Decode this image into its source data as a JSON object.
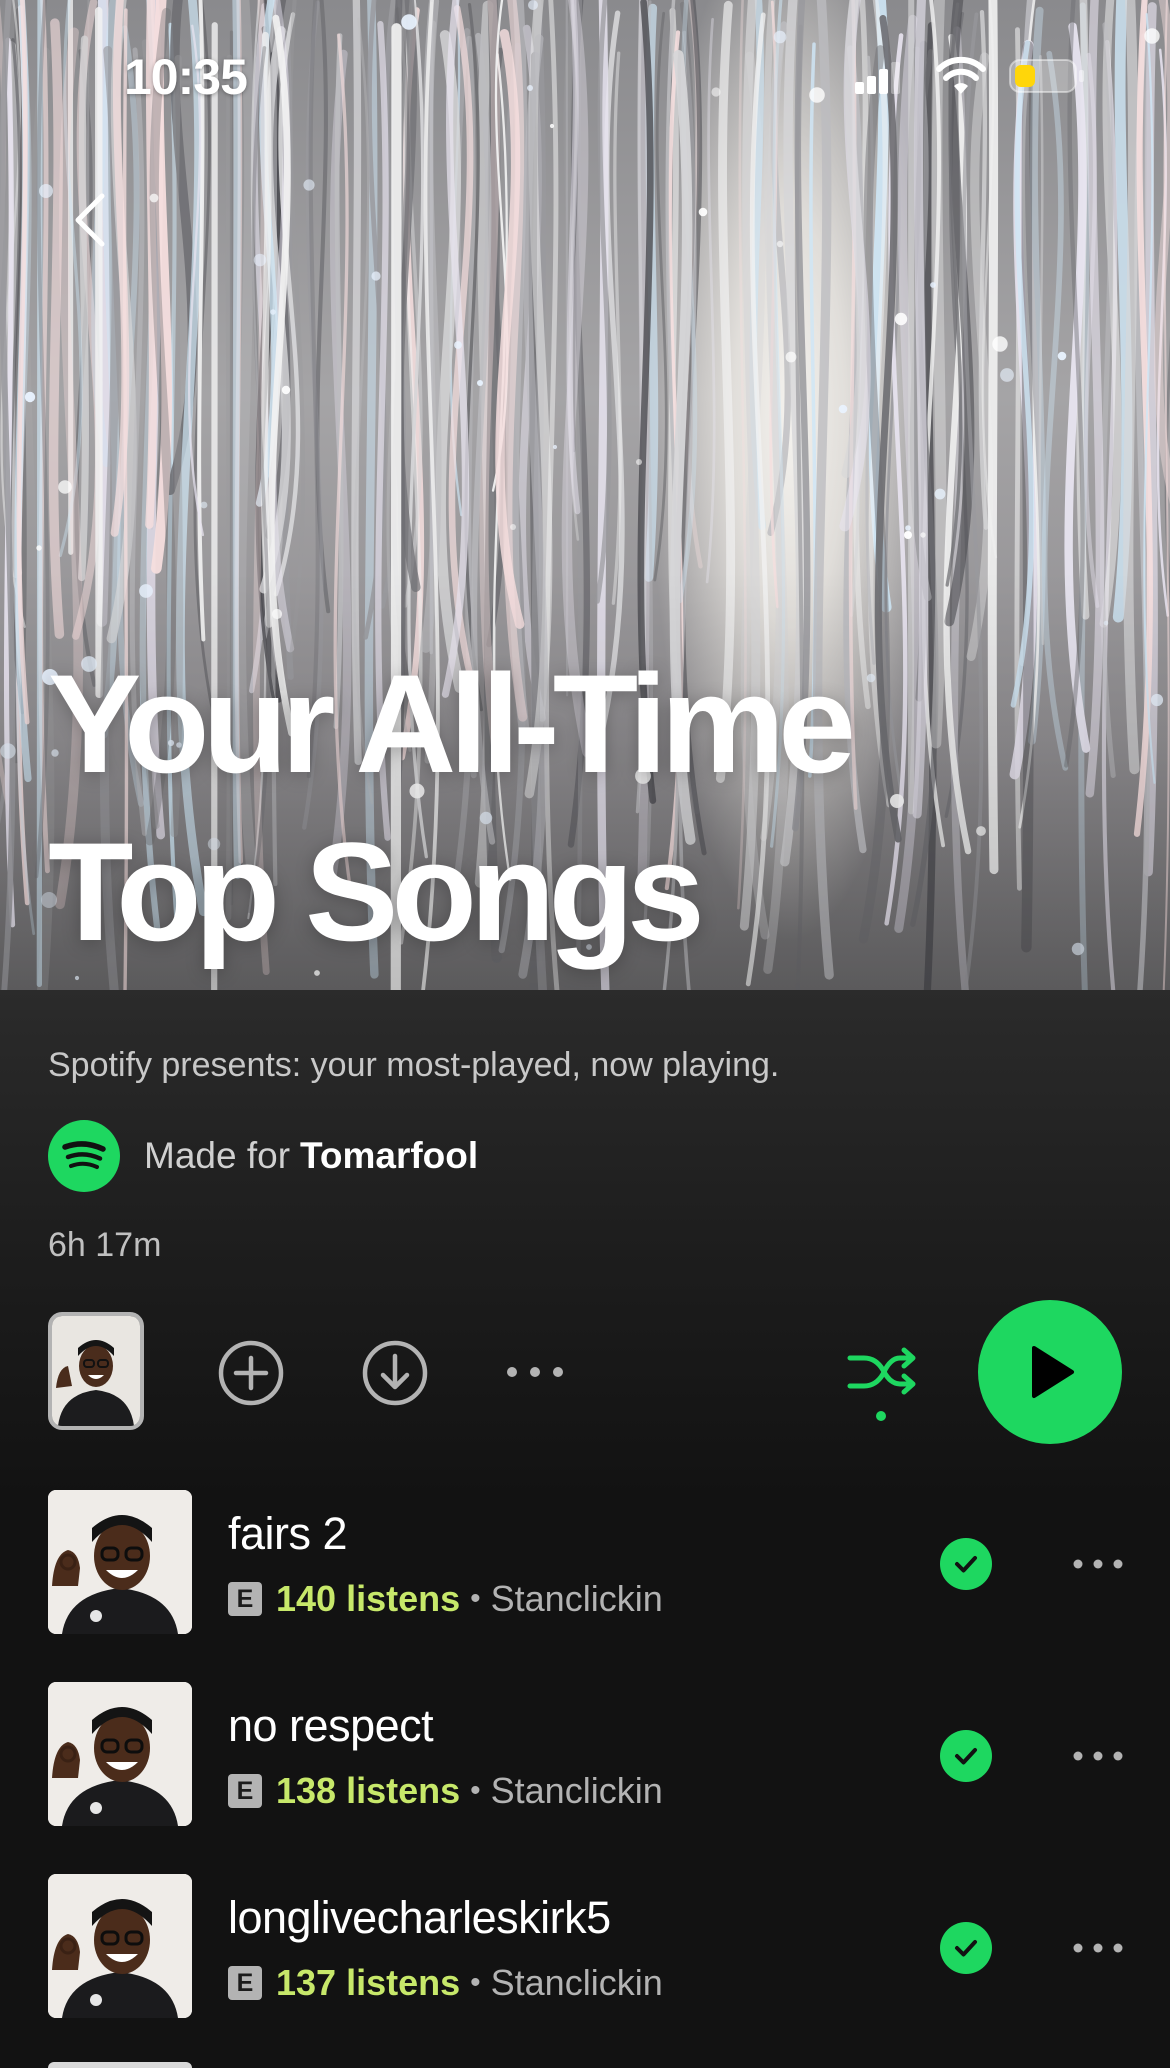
{
  "status_bar": {
    "time": "10:35",
    "icons": [
      "signal-icon",
      "wifi-icon",
      "battery-icon"
    ],
    "battery_color": "#ffd60a"
  },
  "header": {
    "back_icon": "chevron-left-icon",
    "title_line1": "Your All-Time",
    "title_line2": "Top Songs"
  },
  "playlist": {
    "description": "Spotify presents: your most-played, now playing.",
    "made_for_prefix": "Made for",
    "made_for_user": "Tomarfool",
    "duration": "6h 17m"
  },
  "actions": {
    "icons": [
      "cover-thumbnail",
      "add-circle-icon",
      "download-icon",
      "more-horizontal-icon",
      "shuffle-icon",
      "play-icon"
    ],
    "accent_color": "#1ed760"
  },
  "tracks": [
    {
      "title": "fairs 2",
      "explicit": "E",
      "listens": "140 listens",
      "separator": "•",
      "artist": "Stanclickin"
    },
    {
      "title": "no respect",
      "explicit": "E",
      "listens": "138 listens",
      "separator": "•",
      "artist": "Stanclickin"
    },
    {
      "title": "longlivecharleskirk5",
      "explicit": "E",
      "listens": "137 listens",
      "separator": "•",
      "artist": "Stanclickin"
    }
  ],
  "colors": {
    "listens": "#c7e86a",
    "secondary_text": "#b3b3b3",
    "background": "#121212"
  }
}
